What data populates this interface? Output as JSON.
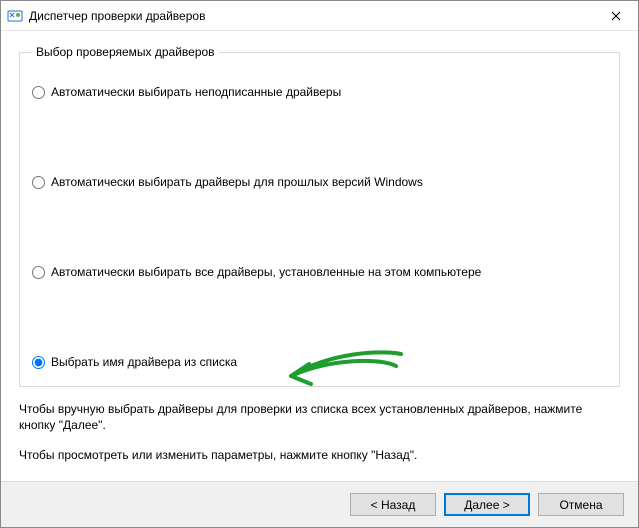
{
  "window": {
    "title": "Диспетчер проверки драйверов"
  },
  "group": {
    "legend": "Выбор проверяемых драйверов",
    "options": {
      "unsigned": "Автоматически выбирать неподписанные драйверы",
      "old_windows": "Автоматически выбирать драйверы для прошлых версий Windows",
      "all_installed": "Автоматически выбирать все драйверы, установленные на этом компьютере",
      "from_list": "Выбрать имя драйвера из списка"
    },
    "selected": "from_list"
  },
  "help": {
    "line1": "Чтобы вручную выбрать драйверы для проверки из списка всех установленных драйверов, нажмите кнопку \"Далее\".",
    "line2": "Чтобы просмотреть или изменить параметры, нажмите кнопку \"Назад\"."
  },
  "buttons": {
    "back": "< Назад",
    "next": "Далее >",
    "cancel": "Отмена"
  }
}
